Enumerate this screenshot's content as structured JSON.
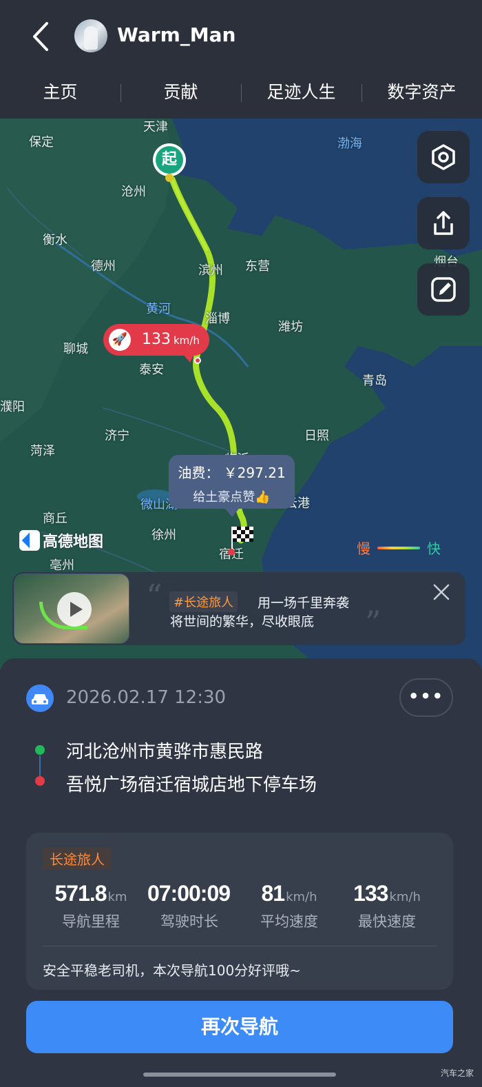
{
  "header": {
    "username": "Warm_Man",
    "tabs": [
      "主页",
      "贡献",
      "足迹人生",
      "数字资产"
    ]
  },
  "map": {
    "labels": {
      "tianjin": "天津",
      "baoding": "保定",
      "cangzhou": "沧州",
      "hengshui": "衡水",
      "dezhou": "德州",
      "binzhou": "滨州",
      "dongying": "东营",
      "yantai": "烟台",
      "huanghe": "黄河",
      "zibo": "淄博",
      "weifang": "潍坊",
      "liaocheng": "聊城",
      "taian": "泰安",
      "qingdao": "青岛",
      "puyang": "濮阳",
      "jining": "济宁",
      "rizhao": "日照",
      "heze": "菏泽",
      "linyi": "临沂",
      "shangqiu": "商丘",
      "weishan": "微山湖",
      "xuzhou": "徐州",
      "lianyungang": "连云港",
      "bozhou": "亳州",
      "suqian": "宿迁",
      "bohai": "渤海"
    },
    "start_pin": "起",
    "max_speed_tag": {
      "value": "133",
      "unit": "km/h"
    },
    "fee_box": {
      "line1": "油费： ￥297.21",
      "line2": "给土豪点赞👍"
    },
    "logo": "高德地图",
    "legend": {
      "slow": "慢",
      "fast": "快"
    },
    "colors": {
      "route": "#a8e02a",
      "speed_tag": "#e23a48",
      "start": "#19a67f"
    }
  },
  "banner": {
    "hashtag": "#长途旅人",
    "line1": "用一场千里奔袭",
    "line2": "将世间的繁华，尽收眼底"
  },
  "trip": {
    "datetime": "2026.02.17 12:30",
    "more": "•••",
    "from": "河北沧州市黄骅市惠民路",
    "to": "吾悦广场宿迁宿城店地下停车场",
    "tag": "长途旅人",
    "stats": [
      {
        "value": "571.8",
        "unit": "km",
        "label": "导航里程"
      },
      {
        "value": "07:00:09",
        "unit": "",
        "label": "驾驶时长"
      },
      {
        "value": "81",
        "unit": "km/h",
        "label": "平均速度"
      },
      {
        "value": "133",
        "unit": "km/h",
        "label": "最快速度"
      }
    ],
    "comment": "安全平稳老司机，本次导航100分好评哦~",
    "nav_button": "再次导航"
  },
  "watermark": "汽车之家"
}
